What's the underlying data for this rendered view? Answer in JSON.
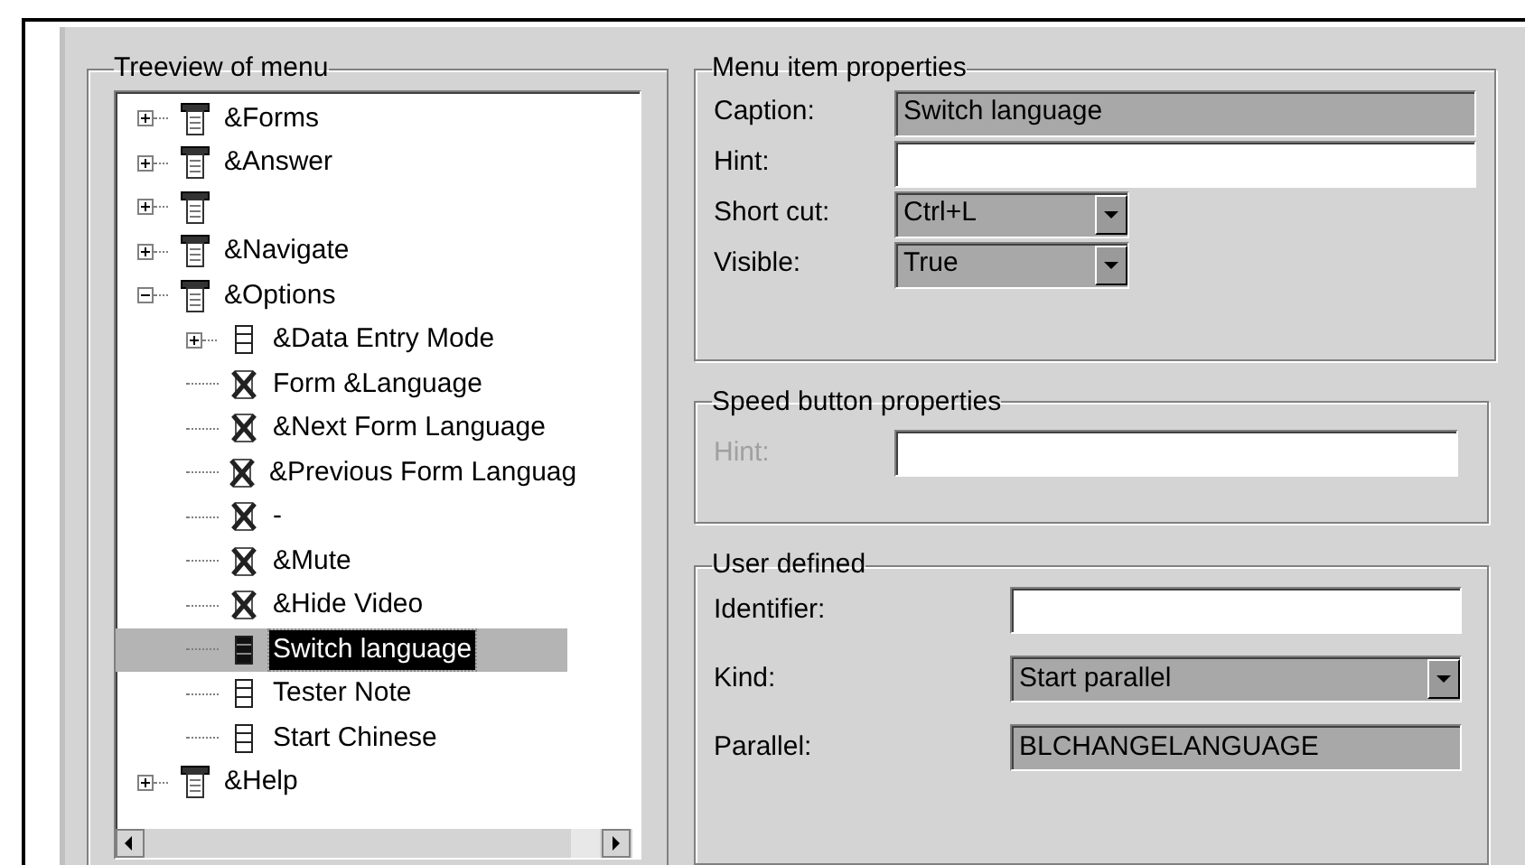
{
  "treeview": {
    "title": "Treeview of menu",
    "items": [
      {
        "label": "&Forms",
        "kind": "menu",
        "expanded": false,
        "selected": false
      },
      {
        "label": "&Answer",
        "kind": "menu",
        "expanded": false,
        "selected": false
      },
      {
        "kind": "menu",
        "expanded": false,
        "selected": false
      },
      {
        "label": "&Navigate",
        "kind": "menu",
        "expanded": false,
        "selected": false
      },
      {
        "label": "&Options",
        "kind": "menu",
        "expanded": true,
        "selected": false,
        "children": [
          {
            "label": "&Data Entry Mode",
            "kind": "item",
            "expanded": false,
            "selected": false
          },
          {
            "label": "Form &Language",
            "kind": "hidden",
            "selected": false
          },
          {
            "label": "&Next Form Language",
            "kind": "hidden",
            "selected": false
          },
          {
            "label": "&Previous Form Languag",
            "kind": "hidden",
            "selected": false
          },
          {
            "label": "-",
            "kind": "hidden",
            "selected": false
          },
          {
            "label": "&Mute",
            "kind": "hidden",
            "selected": false
          },
          {
            "label": "&Hide Video",
            "kind": "hidden",
            "selected": false
          },
          {
            "label": "Switch language",
            "kind": "item",
            "selected": true
          },
          {
            "label": "Tester Note",
            "kind": "item",
            "selected": false
          },
          {
            "label": "Start Chinese",
            "kind": "item",
            "selected": false
          }
        ]
      },
      {
        "label": "&Help",
        "kind": "menu",
        "expanded": false,
        "selected": false
      }
    ]
  },
  "menu_item_properties": {
    "title": "Menu item properties",
    "fields": [
      {
        "label": "Caption:",
        "kind": "text",
        "value": "Switch language",
        "readonly": true,
        "disabled": false
      },
      {
        "label": "Hint:",
        "kind": "text",
        "readonly": false,
        "disabled": false
      },
      {
        "label": "Short cut:",
        "kind": "combo",
        "value": "Ctrl+L",
        "disabled": false
      },
      {
        "label": "Visible:",
        "kind": "combo",
        "value": "True",
        "disabled": false
      }
    ]
  },
  "speed_button_properties": {
    "title": "Speed button properties",
    "fields": [
      {
        "label": "Hint:",
        "kind": "text",
        "readonly": false,
        "disabled": true
      }
    ]
  },
  "user_defined": {
    "title": "User defined",
    "fields": [
      {
        "label": "Identifier:",
        "kind": "text",
        "readonly": false,
        "disabled": false
      },
      {
        "label": "Kind:",
        "kind": "combo",
        "value": "Start parallel",
        "disabled": false
      },
      {
        "label": "Parallel:",
        "kind": "text",
        "value": "BLCHANGELANGUAGE",
        "readonly": true,
        "disabled": false
      }
    ]
  }
}
